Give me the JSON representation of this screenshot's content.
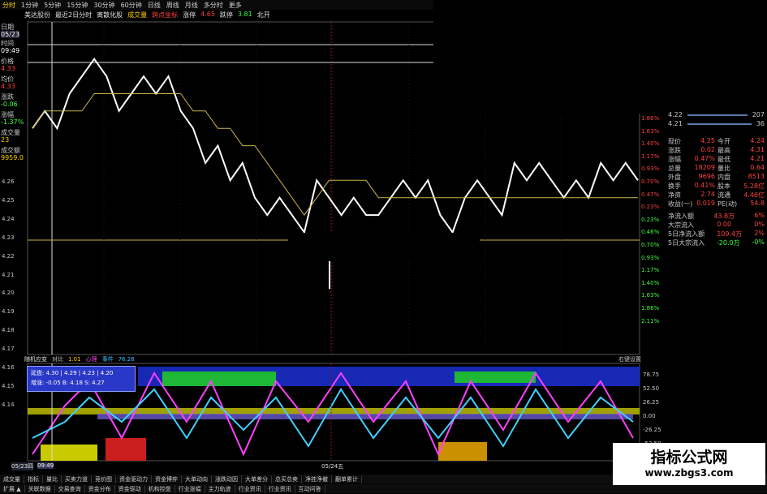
{
  "toolbar": {
    "items": [
      "分时",
      "1分钟",
      "5分钟",
      "15分钟",
      "30分钟",
      "60分钟",
      "日线",
      "周线",
      "月线",
      "多分时",
      "更多"
    ]
  },
  "titlebar": {
    "stock_name": "美达股份",
    "range_label": "最近2日分时",
    "overlay_label": "离散化股",
    "volume_label": "成交量",
    "coords_label": "跨点坐标",
    "price_change_label": "涨停",
    "price_change_value": "4.65",
    "limit_down_label": "跌停",
    "limit_down_value": "3.81",
    "extra_label": "北开"
  },
  "leftcol": {
    "date_label": "日期",
    "date_value": "05/23",
    "time_label": "时间",
    "time_value": "09:49",
    "price_label": "价格",
    "price_value": "4.33",
    "avg_label": "均价",
    "avg_value": "4.33",
    "change_label": "涨跌",
    "change_value": "-0.06",
    "pct_label": "涨幅",
    "pct_value": "-1.37%",
    "vol_label": "成交量",
    "vol_value": "23",
    "amount_label": "成交额",
    "amount_value": "9959.0"
  },
  "price_axis": [
    "4.26",
    "4.25",
    "4.24",
    "4.23",
    "4.22",
    "4.21",
    "4.20",
    "4.19",
    "4.18",
    "4.17",
    "4.16",
    "4.15",
    "4.14"
  ],
  "pct_axis": [
    "1.86%",
    "1.63%",
    "1.40%",
    "1.17%",
    "0.93%",
    "0.70%",
    "0.47%",
    "0.23%",
    "0.23%",
    "0.46%",
    "0.70%",
    "0.93%",
    "1.17%",
    "1.40%",
    "1.63%",
    "1.86%",
    "2.11%"
  ],
  "panel": {
    "order_rows": [
      {
        "price": "4.22",
        "vol": "207"
      },
      {
        "price": "4.21",
        "vol": "36"
      }
    ],
    "quote_rows": [
      {
        "l1": "现价",
        "v1": "4.25",
        "l2": "今开",
        "v2": "4.24"
      },
      {
        "l1": "涨跌",
        "v1": "0.02",
        "l2": "最高",
        "v2": "4.31"
      },
      {
        "l1": "涨幅",
        "v1": "0.47%",
        "l2": "最低",
        "v2": "4.21"
      },
      {
        "l1": "总量",
        "v1": "18209",
        "l2": "量比",
        "v2": "0.64"
      },
      {
        "l1": "外盘",
        "v1": "9696",
        "l2": "内盘",
        "v2": "8513"
      },
      {
        "l1": "换手",
        "v1": "0.41%",
        "l2": "股本",
        "v2": "5.28亿"
      },
      {
        "l1": "净资",
        "v1": "2.74",
        "l2": "流通",
        "v2": "4.46亿"
      },
      {
        "l1": "收益(一)",
        "v1": "0.019",
        "l2": "PE(动)",
        "v2": "54.8"
      }
    ],
    "flow_rows": [
      {
        "label": "净流入额",
        "value": "43.8万",
        "pct": "6%"
      },
      {
        "label": "大宗流入",
        "value": "0.00",
        "pct": "0%"
      },
      {
        "label": "5日净流入额",
        "value": "109.4万",
        "pct": "2%"
      },
      {
        "label": "5日大宗流入",
        "value": "-20.0万",
        "pct": "-0%"
      }
    ]
  },
  "indicator": {
    "name": "随机应变",
    "compare_label": "对比",
    "compare_value": "1.01",
    "heart_label": "心理",
    "event_label": "事件",
    "event_value": "76.28",
    "settings_label": "右键设置",
    "scale": [
      "78.75",
      "52.50",
      "26.25",
      "0.00",
      "-26.25",
      "-52.50"
    ]
  },
  "tooltip": {
    "line1": "延盘: 4.30 | 4.29 | 4.23 | 4.20",
    "line2": "增涨: -0.05 B: 4.18 S: 4.27"
  },
  "time_axis": {
    "start_date": "05/23四",
    "cursor_time": "09:49",
    "mid_date": "05/24五"
  },
  "bottom_tabs_1": [
    "成交量",
    "指标",
    "量比",
    "买卖力道",
    "竞价图",
    "资金驱动力",
    "资金博弈",
    "大单动向",
    "涨跌动因",
    "大单差分",
    "总买总卖",
    "净挂净撤",
    "翻单累计"
  ],
  "bottom_tabs_2": [
    "扩展 ▲",
    "关联数据",
    "交易查询",
    "资金分布",
    "资金驱动",
    "机构控盘",
    "行业涨幅",
    "主力轨迹",
    "行业资讯",
    "行业资讯",
    "互动问答"
  ],
  "watermark": {
    "title": "指标公式网",
    "url": "www.zbgs3.com"
  },
  "chart_data": {
    "type": "line",
    "title": "",
    "series": [
      {
        "name": "",
        "values": [
          4.27,
          4.28,
          4.27,
          4.29,
          4.3,
          4.31,
          4.3,
          4.28,
          4.29,
          4.3,
          4.29,
          4.3,
          4.28,
          4.27,
          4.25,
          4.26,
          4.24,
          4.25,
          4.23,
          4.22,
          4.23,
          4.22,
          4.21,
          4.24,
          4.23,
          4.22,
          4.23,
          4.22,
          4.22,
          4.23,
          4.24,
          4.23,
          4.24,
          4.22,
          4.21,
          4.23,
          4.24,
          4.23,
          4.22,
          4.25,
          4.24,
          4.25,
          4.24,
          4.23,
          4.24,
          4.23,
          4.25,
          4.24,
          4.25,
          4.24
        ]
      },
      {
        "name": "",
        "values": [
          4.27,
          4.28,
          4.28,
          4.28,
          4.28,
          4.29,
          4.29,
          4.29,
          4.29,
          4.29,
          4.29,
          4.29,
          4.29,
          4.28,
          4.28,
          4.27,
          4.27,
          4.26,
          4.26,
          4.25,
          4.24,
          4.23,
          4.22,
          4.23,
          4.24,
          4.24,
          4.24,
          4.24,
          4.23,
          4.23,
          4.23,
          4.23,
          4.23,
          4.23,
          4.23,
          4.23,
          4.23,
          4.23,
          4.23,
          4.23,
          4.23,
          4.23,
          4.23,
          4.23,
          4.23,
          4.23,
          4.23,
          4.23,
          4.23,
          4.23
        ]
      }
    ],
    "colors": [
      "#ffffff",
      "#c8b44a"
    ],
    "ylim": [
      4.14,
      4.33
    ],
    "grid": true
  }
}
